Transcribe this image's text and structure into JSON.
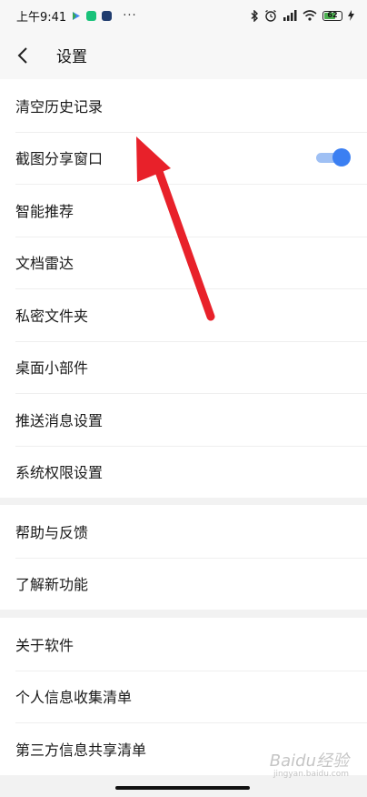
{
  "status_bar": {
    "time": "上午9:41",
    "more": "···",
    "battery": "62"
  },
  "header": {
    "title": "设置"
  },
  "groups": [
    {
      "items": [
        {
          "label": "清空历史记录"
        },
        {
          "label": "截图分享窗口",
          "toggle": true
        },
        {
          "label": "智能推荐"
        },
        {
          "label": "文档雷达"
        },
        {
          "label": "私密文件夹"
        },
        {
          "label": "桌面小部件"
        },
        {
          "label": "推送消息设置"
        },
        {
          "label": "系统权限设置"
        }
      ]
    },
    {
      "items": [
        {
          "label": "帮助与反馈"
        },
        {
          "label": "了解新功能"
        }
      ]
    },
    {
      "items": [
        {
          "label": "关于软件"
        },
        {
          "label": "个人信息收集清单"
        },
        {
          "label": "第三方信息共享清单"
        }
      ]
    }
  ],
  "watermark": {
    "main": "Baidu经验",
    "sub": "jingyan.baidu.com"
  },
  "colors": {
    "accent": "#3b7ff2",
    "annotation_arrow": "#e8212a"
  }
}
